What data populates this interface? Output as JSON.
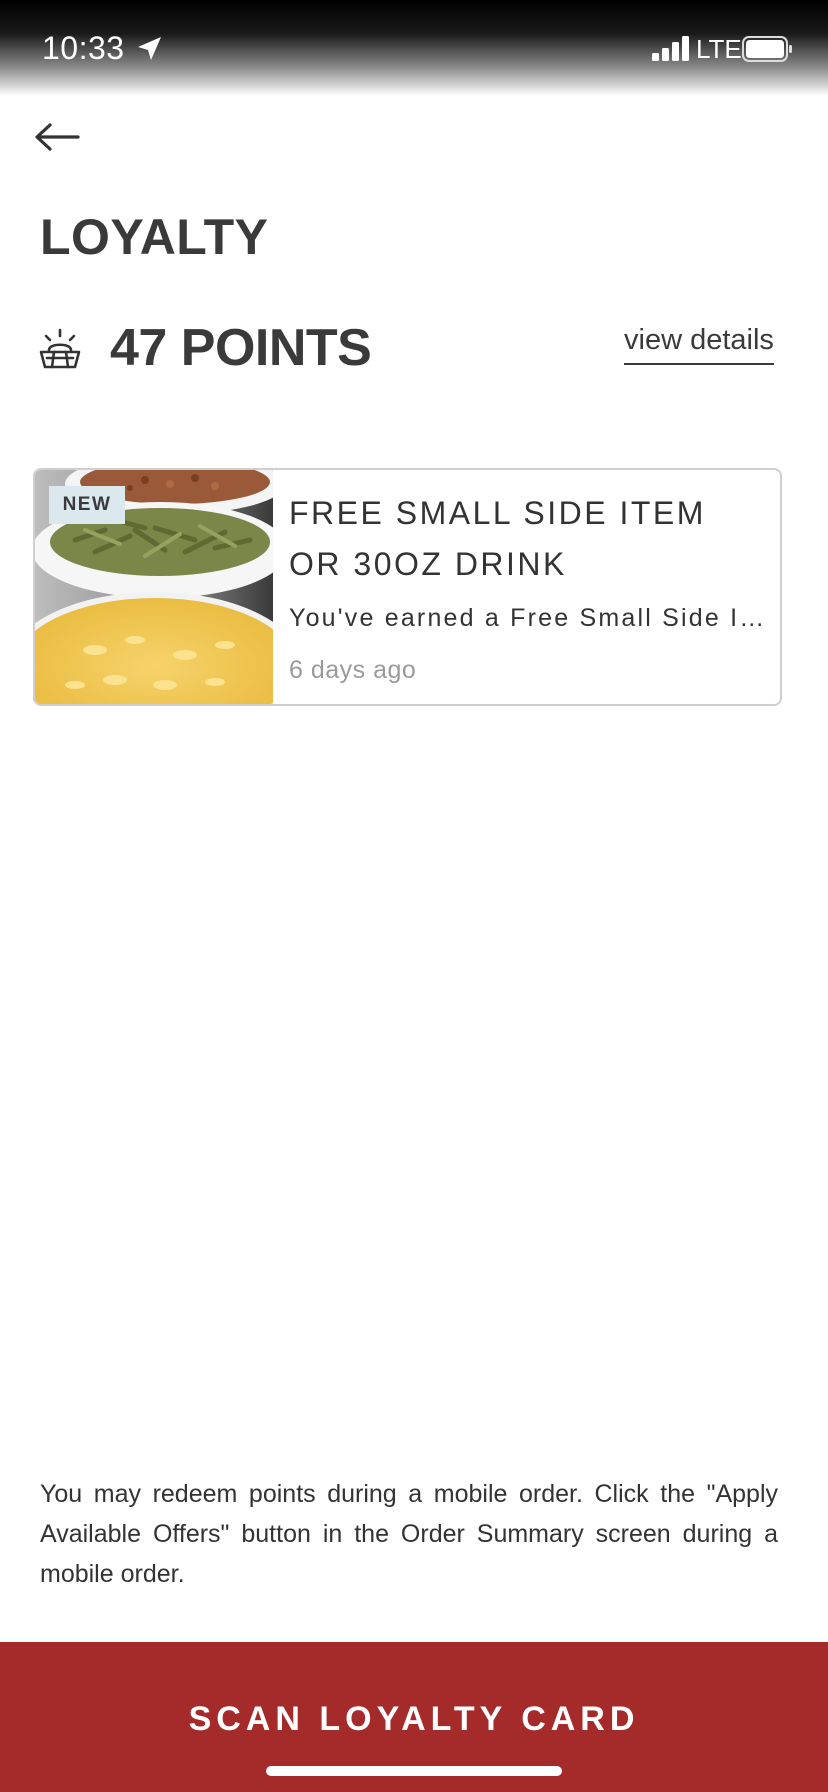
{
  "status_bar": {
    "time": "10:33",
    "network": "LTE",
    "icons": [
      "location-arrow-icon",
      "signal-icon",
      "battery-icon"
    ]
  },
  "header": {
    "back_icon": "arrow-left-icon",
    "title": "LOYALTY"
  },
  "points": {
    "icon": "bread-basket-icon",
    "value": "47 POINTS",
    "view_details_label": "view details"
  },
  "offers": [
    {
      "badge": "NEW",
      "title": "FREE SMALL SIDE ITEM OR 30OZ DRINK",
      "description": "You've earned a Free Small Side Item",
      "time_ago": "6 days ago",
      "image": "side-dishes-photo"
    }
  ],
  "note": "You may redeem points during a mobile order. Click the \"Apply Available Offers\" button in the Order Summary screen during a mobile order.",
  "cta": {
    "label": "SCAN LOYALTY CARD",
    "color": "#a52a2a"
  }
}
